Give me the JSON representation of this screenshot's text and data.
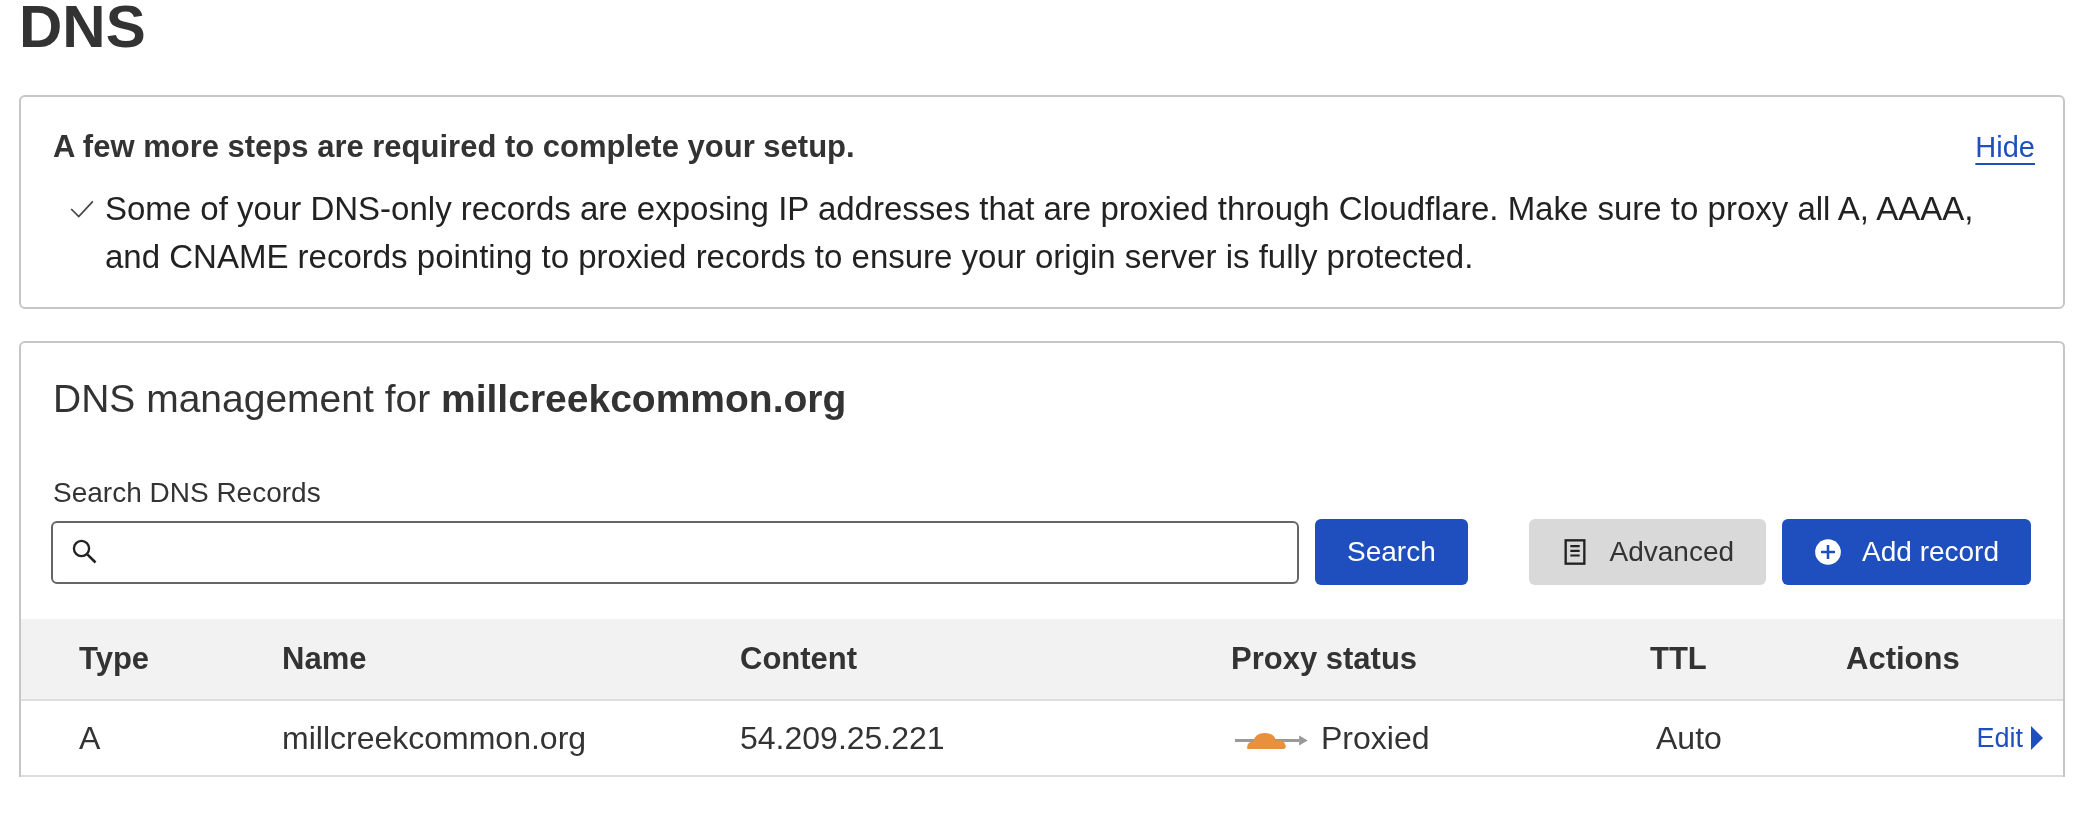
{
  "page_title": "DNS",
  "notice": {
    "heading": "A few more steps are required to complete your setup.",
    "hide_link": "Hide",
    "items": [
      {
        "done": true,
        "text": "Some of your DNS-only records are exposing IP addresses that are proxied through Cloudflare. Make sure to proxy all A, AAAA, and CNAME records pointing to proxied records to ensure your origin server is fully protected."
      }
    ]
  },
  "management": {
    "heading": "DNS management for **millcreekcommon.org**",
    "search": {
      "label": "Search DNS Records",
      "button": "Search"
    },
    "buttons": [
      {
        "kind": "secondary",
        "label": "Advanced"
      },
      {
        "kind": "primary",
        "label": "Add record"
      }
    ],
    "table": {
      "columns": [
        "Type",
        "Name",
        "Content",
        "Proxy status",
        "TTL",
        "Actions"
      ],
      "rows": [
        {
          "type": "A",
          "name": "millcreekcommon.org",
          "content": "54.209.25.221",
          "proxy_status": "Proxied",
          "proxied": true,
          "ttl": "Auto",
          "action": "Edit"
        }
      ]
    }
  }
}
